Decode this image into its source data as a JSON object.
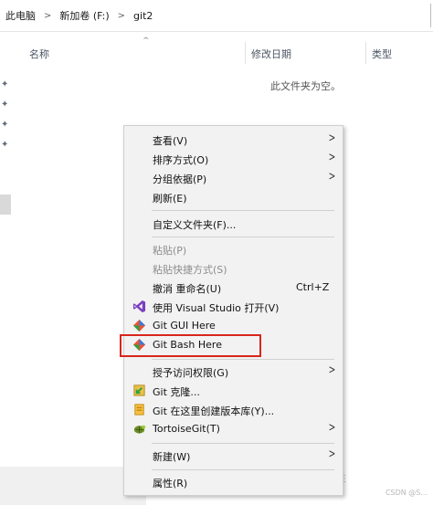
{
  "address": {
    "crumbs": [
      "此电脑",
      "新加卷 (F:)",
      "git2"
    ],
    "separator": ">"
  },
  "nav": {
    "pin_glyph": "✦"
  },
  "columns": {
    "sort_indicator": "^",
    "name": "名称",
    "date": "修改日期",
    "type": "类型"
  },
  "empty_message": "此文件夹为空。",
  "menu": {
    "items": [
      {
        "label": "查看(V)",
        "submenu": true
      },
      {
        "label": "排序方式(O)",
        "submenu": true
      },
      {
        "label": "分组依据(P)",
        "submenu": true
      },
      {
        "label": "刷新(E)"
      },
      {
        "label": "自定义文件夹(F)..."
      },
      {
        "label": "粘贴(P)",
        "disabled": true
      },
      {
        "label": "粘贴快捷方式(S)",
        "disabled": true
      },
      {
        "label": "撤消 重命名(U)",
        "shortcut": "Ctrl+Z"
      },
      {
        "label": "使用 Visual Studio 打开(V)",
        "icon": "visual-studio-icon"
      },
      {
        "label": "Git GUI Here",
        "icon": "git-gui-icon"
      },
      {
        "label": "Git Bash Here",
        "icon": "git-bash-icon"
      },
      {
        "label": "授予访问权限(G)",
        "submenu": true
      },
      {
        "label": "Git 克隆...",
        "icon": "git-clone-icon"
      },
      {
        "label": "Git 在这里创建版本库(Y)...",
        "icon": "git-create-repo-icon"
      },
      {
        "label": "TortoiseGit(T)",
        "icon": "tortoisegit-icon",
        "submenu": true
      },
      {
        "label": "新建(W)",
        "submenu": true
      },
      {
        "label": "属性(R)"
      }
    ],
    "submenu_arrow": ">"
  },
  "colors": {
    "highlight_border": "#d9261c",
    "visual_studio": "#7b3fbf",
    "git_orange": "#f05033",
    "git_green": "#2ea043",
    "git_blue": "#3a7bd5"
  },
  "watermark": "CSDN @S...",
  "faint_text": "E"
}
